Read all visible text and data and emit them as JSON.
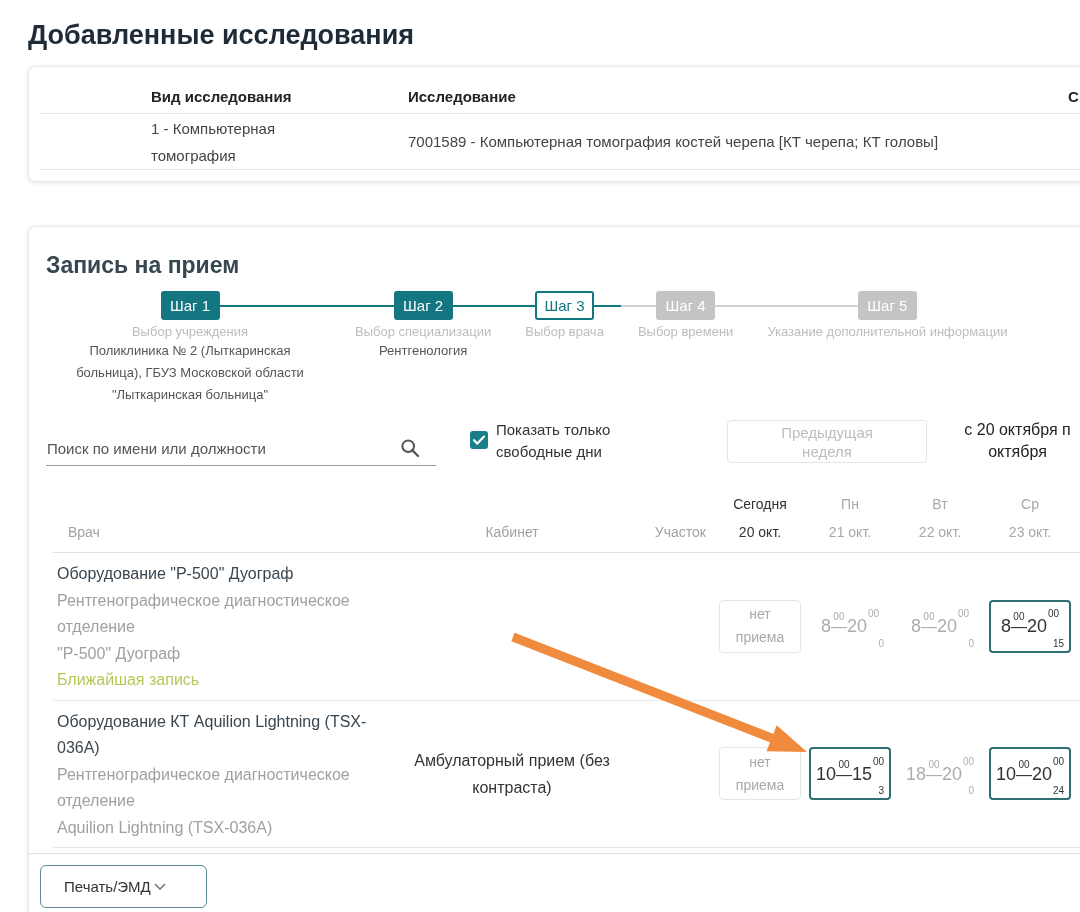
{
  "added_studies": {
    "title": "Добавленные исследования",
    "column_headers": [
      "Вид исследования",
      "Исследование"
    ],
    "column_3": "С",
    "rows": [
      {
        "study_type": "1 - Компьютерная томография",
        "study": "7001589 - Компьютерная томография костей черепа [КТ черепа; КТ головы]"
      }
    ]
  },
  "appointment": {
    "title": "Запись на прием",
    "steps": [
      {
        "label": "Шаг 1",
        "caption": "Выбор учреждения",
        "value": "Поликлиника № 2 (Лыткаринская больница), ГБУЗ Московской области \"Лыткаринская больница\"",
        "completed": true,
        "active": false
      },
      {
        "label": "Шаг 2",
        "caption": "Выбор специализации",
        "value": "Рентгенология",
        "completed": true,
        "active": false
      },
      {
        "label": "Шаг 3",
        "caption": "Выбор врача",
        "completed": false,
        "active": true
      },
      {
        "label": "Шаг 4",
        "caption": "Выбор времени",
        "completed": false,
        "active": false
      },
      {
        "label": "Шаг 5",
        "caption": "Указание дополнительной информации",
        "completed": false,
        "active": false
      }
    ],
    "search": {
      "placeholder": "Поиск по имени или должности"
    },
    "free_days_only": {
      "label": "Показать только свободные дни",
      "checked": true
    },
    "previous_week": {
      "label": "Предыдущая неделя",
      "disabled": true
    },
    "week_range": [
      "с 20 октября п",
      "октября"
    ],
    "table": {
      "columns": [
        "Врач",
        "Кабинет",
        "Участок"
      ],
      "days": [
        {
          "weekday": "Сегодня",
          "date": "20 окт.",
          "today": true
        },
        {
          "weekday": "Пн",
          "date": "21 окт.",
          "today": false
        },
        {
          "weekday": "Вт",
          "date": "22 окт.",
          "today": false
        },
        {
          "weekday": "Ср",
          "date": "23 окт.",
          "today": false
        }
      ],
      "rows": [
        {
          "name": "Оборудование \"Р-500\" Дуограф",
          "department": "Рентгенографическое диагностическое отделение",
          "device": "\"Р-500\" Дуограф",
          "link": "Ближайшая запись",
          "slots": [
            {
              "kind": "closed",
              "text": "нет приема"
            },
            {
              "kind": "time",
              "start": "8",
              "start_min": "00",
              "dash": "—",
              "end": "20",
              "end_min": "00",
              "count": "0",
              "available": false
            },
            {
              "kind": "time",
              "start": "8",
              "start_min": "00",
              "dash": "—",
              "end": "20",
              "end_min": "00",
              "count": "0",
              "available": false
            },
            {
              "kind": "time",
              "start": "8",
              "start_min": "00",
              "dash": "—",
              "end": "20",
              "end_min": "00",
              "count": "15",
              "available": true
            }
          ]
        },
        {
          "name": "Оборудование КТ Aquilion Lightning (TSX-036A)",
          "department": "Рентгенографическое диагностическое отделение",
          "device": "Aquilion Lightning (TSX-036A)",
          "cabinet": "Амбулаторный прием (без контраста)",
          "slots": [
            {
              "kind": "closed",
              "text": "нет приема"
            },
            {
              "kind": "time",
              "start": "10",
              "start_min": "00",
              "dash": "—",
              "end": "15",
              "end_min": "00",
              "count": "3",
              "available": true
            },
            {
              "kind": "time",
              "start": "18",
              "start_min": "00",
              "dash": "—",
              "end": "20",
              "end_min": "00",
              "count": "0",
              "available": false
            },
            {
              "kind": "time",
              "start": "10",
              "start_min": "00",
              "dash": "—",
              "end": "20",
              "end_min": "00",
              "count": "24",
              "available": true
            }
          ]
        }
      ]
    }
  },
  "footer": {
    "print_button": "Печать/ЭМД"
  }
}
